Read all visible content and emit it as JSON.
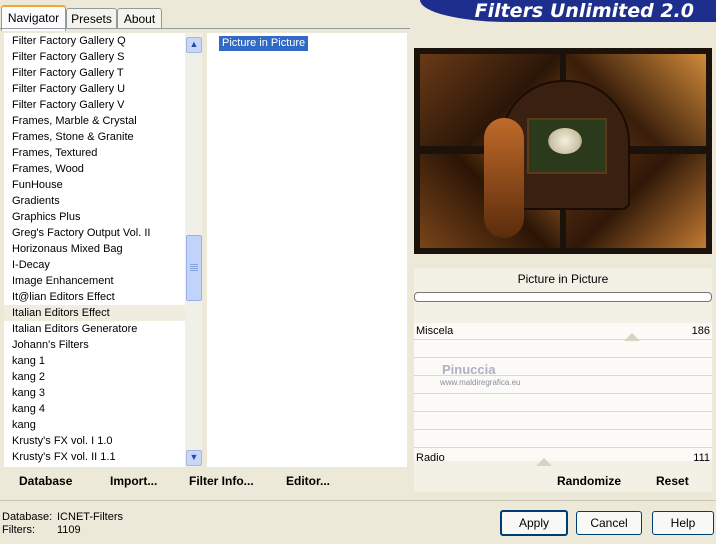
{
  "tabs": [
    "Navigator",
    "Presets",
    "About"
  ],
  "app_title": "Filters Unlimited 2.0",
  "categories": [
    "Filter Factory Gallery Q",
    "Filter Factory Gallery S",
    "Filter Factory Gallery T",
    "Filter Factory Gallery U",
    "Filter Factory Gallery V",
    "Frames, Marble & Crystal",
    "Frames, Stone & Granite",
    "Frames, Textured",
    "Frames, Wood",
    "FunHouse",
    "Gradients",
    "Graphics Plus",
    "Greg's Factory Output Vol. II",
    "Horizonaus Mixed Bag",
    "I-Decay",
    "Image Enhancement",
    "It@lian Editors Effect",
    "Italian Editors Effect",
    "Italian Editors Generatore",
    "Johann's Filters",
    "kang 1",
    "kang 2",
    "kang 3",
    "kang 4",
    "kang",
    "Krusty's FX vol. I 1.0",
    "Krusty's FX vol. II 1.1"
  ],
  "selected_category": "Italian Editors Effect",
  "filters": [
    "Picture in Picture"
  ],
  "panel": {
    "filter_name": "Picture in Picture",
    "params": [
      {
        "label": "Miscela",
        "value": "186",
        "level": 0.73
      },
      {
        "label": "Radio",
        "value": "111",
        "level": 0.435
      }
    ],
    "watermark": "Pinuccia",
    "watermark_url": "www.maldiregrafica.eu"
  },
  "toolbar": {
    "database": "Database",
    "import": "Import...",
    "filter_info": "Filter Info...",
    "editor": "Editor...",
    "randomize": "Randomize",
    "reset": "Reset"
  },
  "status": {
    "database_label": "Database:",
    "database_value": "ICNET-Filters",
    "filters_label": "Filters:",
    "filters_value": "1109"
  },
  "dialog_buttons": {
    "apply": "Apply",
    "cancel": "Cancel",
    "help": "Help"
  }
}
